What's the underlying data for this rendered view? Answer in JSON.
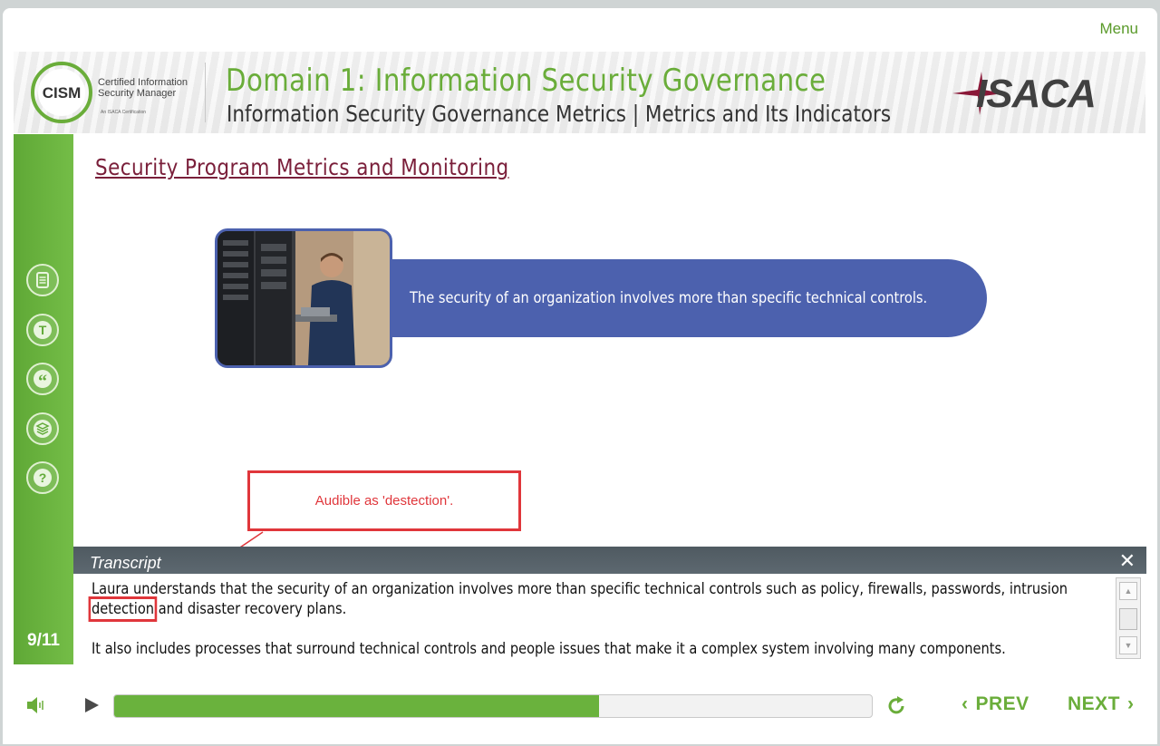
{
  "header": {
    "menu_label": "Menu",
    "cism_logo_text": "CISM",
    "cism_line1": "Certified Information",
    "cism_line2": "Security Manager",
    "cism_tagline": "An ISACA Certification",
    "domain_title": "Domain 1: Information Security Governance",
    "domain_subtitle": "Information Security Governance Metrics | Metrics and Its Indicators",
    "isaca_logo_text": "ISACA"
  },
  "sidebar": {
    "buttons": [
      {
        "name": "notes-icon"
      },
      {
        "name": "glossary-icon",
        "glyph": "T"
      },
      {
        "name": "quote-icon",
        "glyph": "“"
      },
      {
        "name": "resources-icon"
      },
      {
        "name": "help-icon",
        "glyph": "?"
      }
    ],
    "page_counter": "9/11"
  },
  "slide": {
    "title": "Security Program Metrics and Monitoring",
    "statement": "The security of an organization involves more than specific technical controls."
  },
  "annotation": {
    "callout_text": "Audible as 'destection'."
  },
  "transcript": {
    "title": "Transcript",
    "close_glyph": "✕",
    "line1": "Laura understands that the security of an organization involves more than specific technical controls such as policy, firewalls, passwords, intrusion",
    "line2_highlight": "detection",
    "line2_rest": " and disaster recovery plans.",
    "line3": "It also includes processes that surround technical controls and people issues that make it a complex system involving many components."
  },
  "player": {
    "progress_fraction": 0.64,
    "prev_label": "PREV",
    "next_label": "NEXT"
  },
  "colors": {
    "accent_green": "#6aad3a",
    "pill_blue": "#4c61ae",
    "title_maroon": "#7a1f3a",
    "annotation_red": "#e0363b"
  }
}
